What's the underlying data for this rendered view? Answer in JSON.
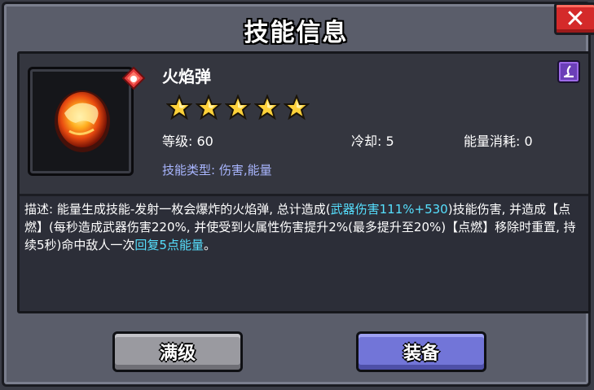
{
  "dialog": {
    "title": "技能信息",
    "close_label": "✕"
  },
  "skill": {
    "name": "火焰弹",
    "stars": 5,
    "level_label": "等级: 60",
    "cooldown_label": "冷却: 5",
    "energy_label": "能量消耗: 0",
    "type_label": "技能类型: 伤害,能量",
    "element_icon": "fire-element-icon",
    "type_icon": "purple-spell-icon"
  },
  "description": {
    "part1": "描述: 能量生成技能-发射一枚会爆炸的火焰弹, 总计造成(",
    "highlight1": "武器伤害111%+530",
    "part2": ")技能伤害, 并造成【点燃】(每秒造成武器伤害220%, 并使受到火属性伤害提升2%(最多提升至20%)【点燃】移除时重置, 持续5秒)命中敌人一次",
    "highlight2": "回复5点能量",
    "part3": "。"
  },
  "buttons": {
    "max_label": "满级",
    "equip_label": "装备"
  },
  "colors": {
    "highlight": "#56e0ff",
    "skill_type": "#a9b6ff",
    "close": "#d42a2a",
    "equip": "#7275d8"
  }
}
